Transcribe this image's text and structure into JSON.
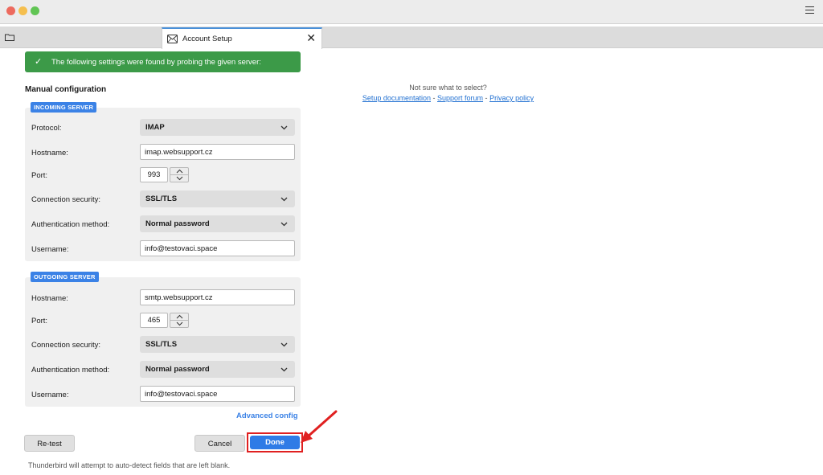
{
  "tab": {
    "label": "Account Setup"
  },
  "notice": {
    "text": "The following settings were found by probing the given server:"
  },
  "manual_title": "Manual configuration",
  "help": {
    "question": "Not sure what to select?",
    "setup_doc": "Setup documentation",
    "support": "Support forum",
    "privacy": "Privacy policy",
    "sep": "-"
  },
  "incoming": {
    "badge": "INCOMING SERVER",
    "protocol_label": "Protocol:",
    "protocol_value": "IMAP",
    "hostname_label": "Hostname:",
    "hostname_value": "imap.websupport.cz",
    "port_label": "Port:",
    "port_value": "993",
    "security_label": "Connection security:",
    "security_value": "SSL/TLS",
    "auth_label": "Authentication method:",
    "auth_value": "Normal password",
    "username_label": "Username:",
    "username_value": "info@testovaci.space"
  },
  "outgoing": {
    "badge": "OUTGOING SERVER",
    "hostname_label": "Hostname:",
    "hostname_value": "smtp.websupport.cz",
    "port_label": "Port:",
    "port_value": "465",
    "security_label": "Connection security:",
    "security_value": "SSL/TLS",
    "auth_label": "Authentication method:",
    "auth_value": "Normal password",
    "username_label": "Username:",
    "username_value": "info@testovaci.space"
  },
  "advanced_config": "Advanced config",
  "buttons": {
    "retest": "Re-test",
    "cancel": "Cancel",
    "done": "Done"
  },
  "footer_note": "Thunderbird will attempt to auto-detect fields that are left blank.",
  "icons": {
    "folder": "folder-icon",
    "tab": "envelope-icon",
    "check": "check-icon",
    "chevron": "chevron-down-icon",
    "arrow": "annotation-arrow-icon"
  },
  "colors": {
    "accent": "#3b82e6",
    "success": "#3c9a48",
    "highlight": "#e02020"
  }
}
